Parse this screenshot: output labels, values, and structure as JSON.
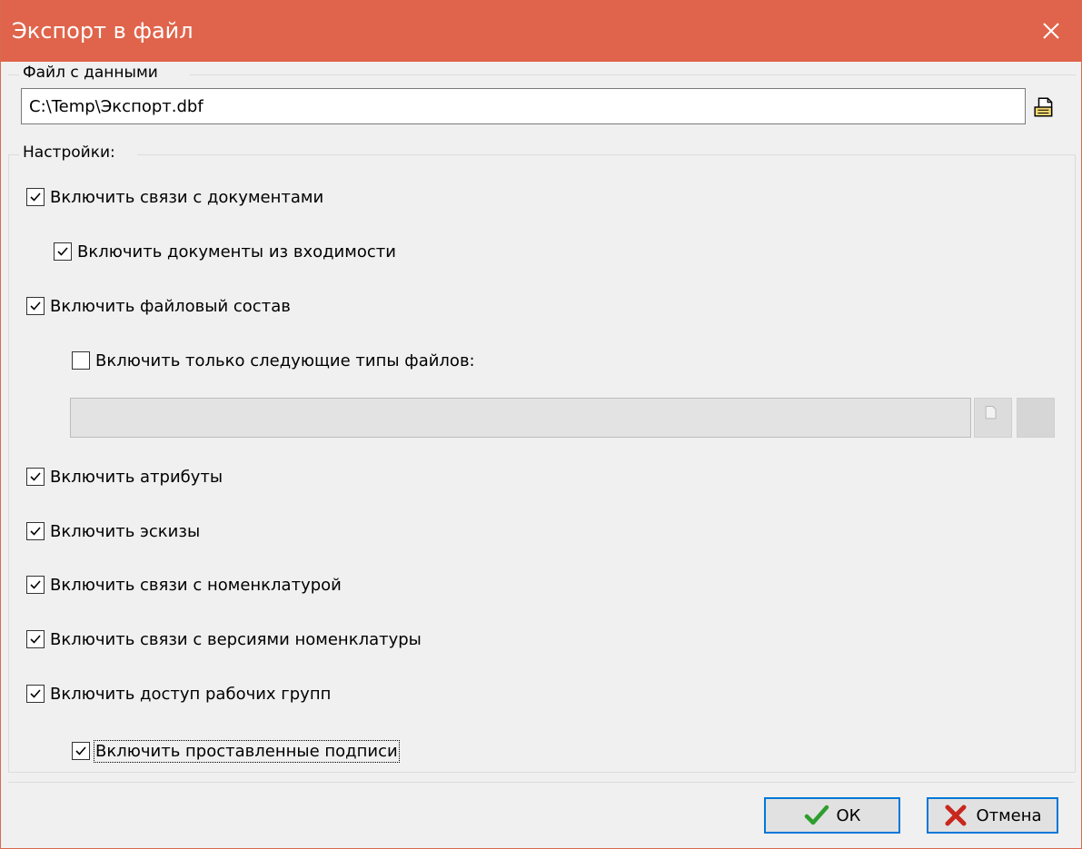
{
  "window": {
    "title": "Экспорт в файл"
  },
  "file_group": {
    "label": "Файл с данными",
    "path_value": "C:\\Temp\\Экспорт.dbf"
  },
  "settings": {
    "label": "Настройки:",
    "items": [
      {
        "label": "Включить связи с документами",
        "checked": true
      },
      {
        "label": "Включить документы из входимости",
        "checked": true
      },
      {
        "label": "Включить файловый состав",
        "checked": true
      },
      {
        "label": "Включить только следующие типы файлов:",
        "checked": false
      },
      {
        "label": "Включить атрибуты",
        "checked": true
      },
      {
        "label": "Включить эскизы",
        "checked": true
      },
      {
        "label": "Включить связи с номенклатурой",
        "checked": true
      },
      {
        "label": "Включить связи с версиями номенклатуры",
        "checked": true
      },
      {
        "label": "Включить доступ рабочих групп",
        "checked": true
      },
      {
        "label": "Включить проставленные подписи",
        "checked": true
      }
    ],
    "file_types_value": ""
  },
  "buttons": {
    "ok_label": "ОК",
    "cancel_label": "Отмена"
  },
  "colors": {
    "titlebar": "#e0644b",
    "focus_border": "#0078d7",
    "ok_icon": "#2e9e2e",
    "cancel_icon": "#c8281e"
  },
  "icons": {
    "close": "close-icon",
    "browse": "open-file-icon",
    "ok": "checkmark-icon",
    "cancel": "cross-icon"
  }
}
